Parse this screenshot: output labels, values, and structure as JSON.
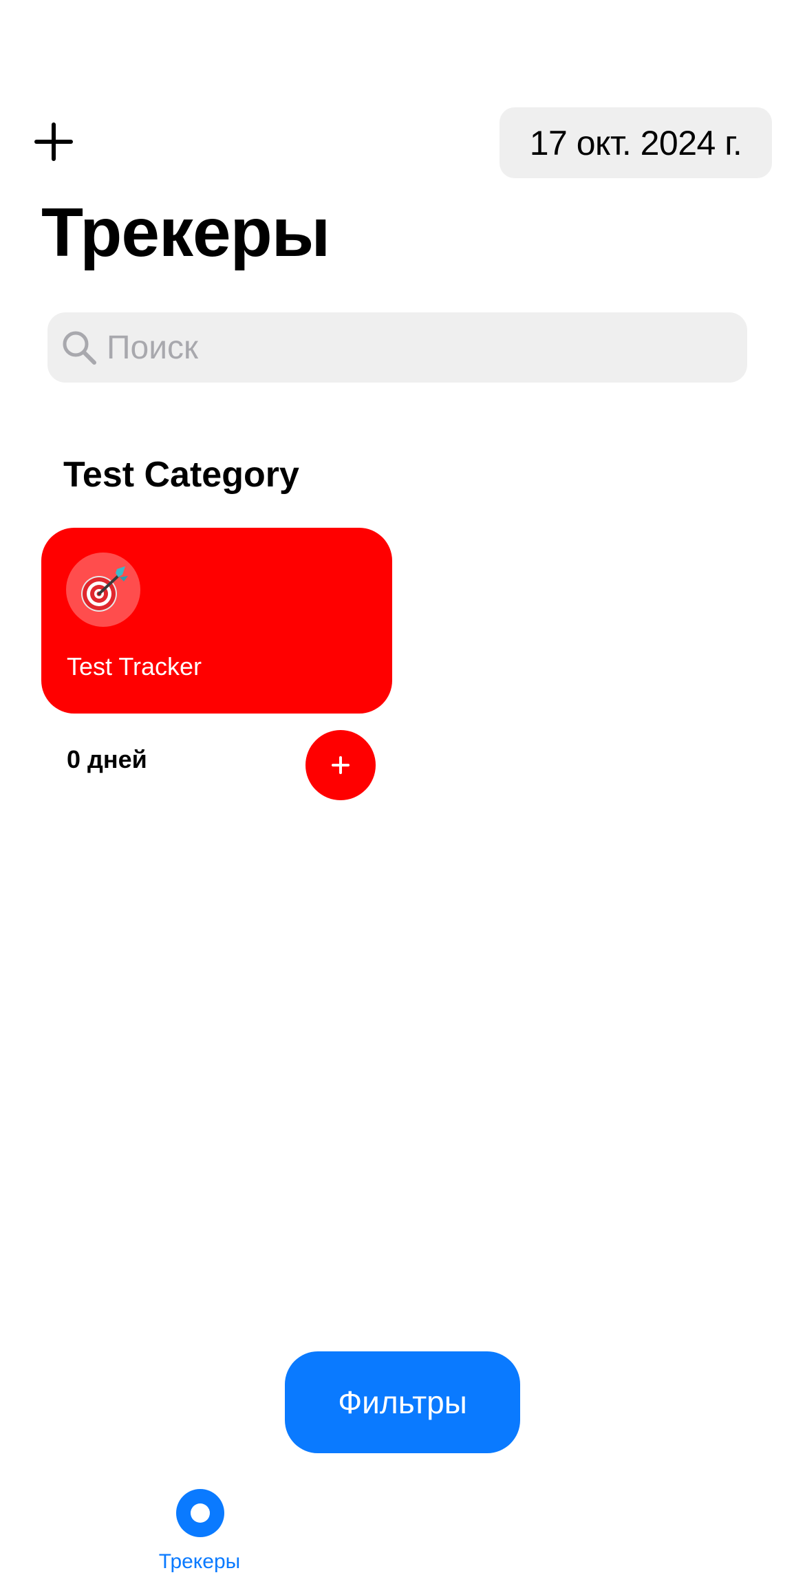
{
  "header": {
    "add_icon": "plus-icon",
    "date_label": "17 окт. 2024 г."
  },
  "page": {
    "title": "Трекеры"
  },
  "search": {
    "placeholder": "Поиск",
    "value": "",
    "icon": "search-icon"
  },
  "categories": [
    {
      "title": "Test Category",
      "trackers": [
        {
          "name": "Test Tracker",
          "emoji": "🎯",
          "color": "#ff0000",
          "days_label": "0 дней",
          "complete_icon": "plus-icon"
        }
      ]
    }
  ],
  "filters": {
    "label": "Фильтры"
  },
  "tab_bar": {
    "items": [
      {
        "label": "Трекеры",
        "icon": "tracker-circle-icon",
        "active": true
      }
    ]
  },
  "colors": {
    "accent_blue": "#0a7aff",
    "tracker_red": "#ff0000",
    "field_gray": "#efefef",
    "placeholder_gray": "#a8a8ad"
  }
}
